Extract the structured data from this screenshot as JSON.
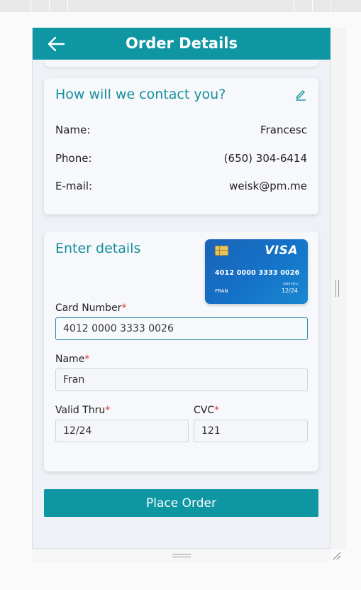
{
  "header": {
    "title": "Order Details",
    "back_icon": "arrow-left-icon"
  },
  "colors": {
    "accent": "#0f96a3",
    "required": "#e03a3a"
  },
  "contact": {
    "title": "How will we contact you?",
    "edit_icon": "pencil-icon",
    "rows": [
      {
        "label": "Name:",
        "value": "Francesc"
      },
      {
        "label": "Phone:",
        "value": "(650) 304-6414"
      },
      {
        "label": "E-mail:",
        "value": "weisk@pm.me"
      }
    ]
  },
  "payment": {
    "title": "Enter details",
    "card_preview": {
      "brand": "VISA",
      "number": "4012 0000 3333 0026",
      "holder": "FRAN",
      "valid_label": "valid thru",
      "expiry": "12/24"
    },
    "required_mark": "*",
    "card_number": {
      "label": "Card Number",
      "value": "4012 0000 3333 0026"
    },
    "name": {
      "label": "Name",
      "value": "Fran"
    },
    "valid_thru": {
      "label": "Valid Thru",
      "value": "12/24"
    },
    "cvc": {
      "label": "CVC",
      "value": "121"
    }
  },
  "place_order_label": "Place Order"
}
